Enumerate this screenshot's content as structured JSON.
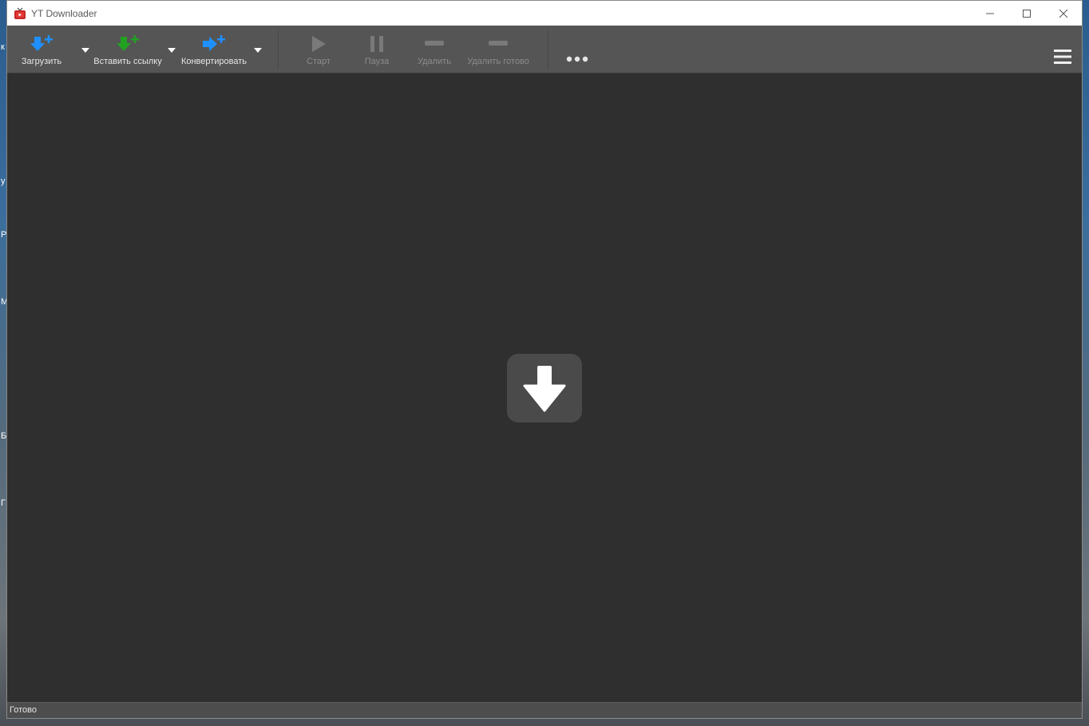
{
  "desktop": {
    "edge_letters": [
      "к",
      "у",
      "Р",
      "М",
      "Б",
      "Г"
    ]
  },
  "window": {
    "title": "YT Downloader",
    "controls": [
      "minimize",
      "maximize",
      "close"
    ]
  },
  "toolbar": {
    "download_label": "Загрузить",
    "paste_link_label": "Вставить ссылку",
    "convert_label": "Конвертировать",
    "start_label": "Старт",
    "pause_label": "Пауза",
    "delete_label": "Удалить",
    "delete_done_label": "Удалить готово",
    "colors": {
      "download": "#1e90ff",
      "paste": "#22a022",
      "convert": "#1e90ff",
      "disabled": "#7a7a7a"
    }
  },
  "content": {
    "drop_icon": "download-arrow-icon"
  },
  "status": {
    "text": "Готово"
  }
}
